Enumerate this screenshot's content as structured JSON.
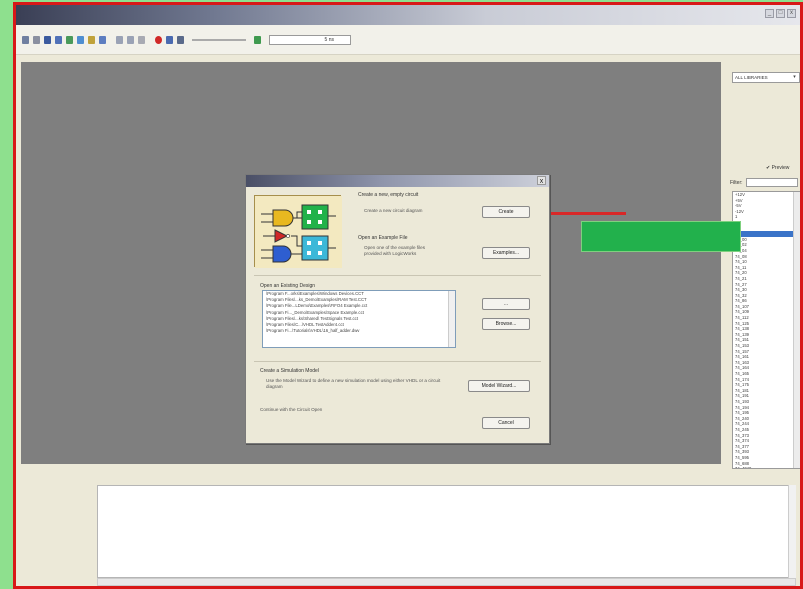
{
  "window": {
    "controls": [
      "_",
      "□",
      "x"
    ]
  },
  "toolbar": {
    "sim_time": "5 ns"
  },
  "right_panel": {
    "library_combo": "ALL LIBRARIES",
    "preview_label": "Preview",
    "filter_label": "Filter:",
    "parts": [
      "+12V",
      "+5V",
      "-5V",
      "-12V",
      "1",
      "2",
      "3",
      "4",
      "74_00",
      "74_02",
      "74_04",
      "74_08",
      "74_10",
      "74_11",
      "74_20",
      "74_21",
      "74_27",
      "74_30",
      "74_32",
      "74_86",
      "74_107",
      "74_109",
      "74_112",
      "74_125",
      "74_138",
      "74_139",
      "74_151",
      "74_153",
      "74_157",
      "74_161",
      "74_163",
      "74_164",
      "74_165",
      "74_174",
      "74_175",
      "74_181",
      "74_191",
      "74_193",
      "74_194",
      "74_195",
      "74_240",
      "74_244",
      "74_245",
      "74_373",
      "74_374",
      "74_377",
      "74_393",
      "74_595",
      "74_688",
      "74_4040",
      "74_4060",
      "74_4511",
      "74_4518"
    ],
    "selected_part_index": 7
  },
  "dialog": {
    "close": "x",
    "create_heading": "Create a new, empty circuit",
    "create_desc": "Create a new circuit diagram",
    "create_button": "Create",
    "example_heading": "Open an Example File",
    "example_desc": "Open one of the example files provided with LogicWorks",
    "examples_button": "Examples...",
    "existing_heading": "Open an Existing Design",
    "existing_files": [
      "\\Program F...orks\\Examples\\Windows Devices.CCT",
      "\\Program Files\\...ks_Demo\\Examples\\RAM Test.CCT",
      "\\Program File...LDemo\\Examples\\FIFO4 Example.cct",
      "\\Program Fi..._Demo\\Examples\\Space Example.cct",
      "\\Program Files\\...ks\\Shared\\ TestSignals Test.cct",
      "\\Program Files\\C...\\VHDL TestAdder4.cct",
      "\\Program Fi...\\Tutorials\\VHDL\\16_half_adder.dwv"
    ],
    "open_button": "...",
    "browse_button": "Browse...",
    "sim_heading": "Create a Simulation Model",
    "sim_desc": "Use the Model Wizard to define a new simulation model using either VHDL or a circuit diagram",
    "model_wizard_button": "Model Wizard...",
    "continue_text": "Continue with the Circuit Open",
    "cancel_button": "Cancel"
  }
}
